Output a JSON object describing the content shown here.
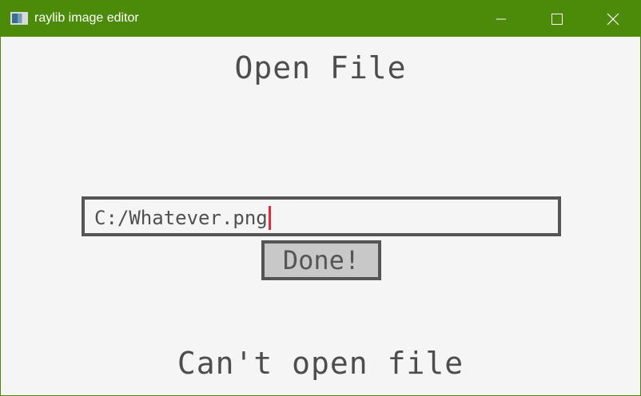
{
  "window": {
    "title": "raylib image editor",
    "icon": "raylib-app-icon",
    "controls": [
      "minimize-icon",
      "maximize-icon",
      "close-icon"
    ],
    "titlebar_color": "#4c8a0a"
  },
  "dialog": {
    "heading": "Open File",
    "path_input": {
      "value": "C:/Whatever.png"
    },
    "done_button": "Done!",
    "status_message": "Can't open file"
  },
  "colors": {
    "text": "#4d4d4d",
    "border": "#555555",
    "button_bg": "#c8c8c8",
    "caret": "#e2283a",
    "background": "#f5f5f5"
  }
}
